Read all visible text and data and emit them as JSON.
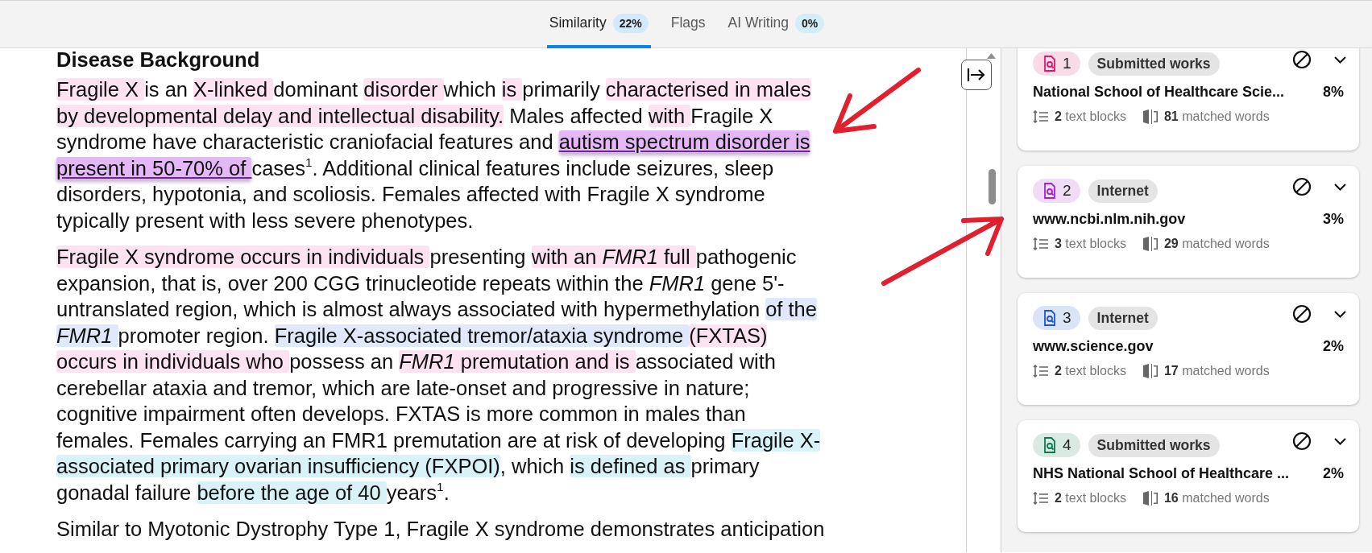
{
  "tabs": [
    {
      "label": "Similarity",
      "badge": "22%",
      "selected": true,
      "color": "#d4e9fb"
    },
    {
      "label": "Flags",
      "selected": false
    },
    {
      "label": "AI Writing",
      "badge": "0%",
      "selected": false,
      "color": "#d3eef8"
    }
  ],
  "document": {
    "heading": "Disease Background",
    "paragraphs": [
      {
        "lines": [
          {
            "segments": [
              {
                "text": "Fragile X ",
                "color": "#fde3f1",
                "active": false
              },
              {
                "text": "is an "
              },
              {
                "text": "X-linked ",
                "color": "#fde3f1",
                "active": false
              },
              {
                "text": "dominant "
              },
              {
                "text": "disorder ",
                "color": "#fde3f1",
                "active": false
              },
              {
                "text": "which "
              },
              {
                "text": "is ",
                "color": "#fde3f1",
                "active": false
              },
              {
                "text": "primarily "
              },
              {
                "text": "characterised in males",
                "color": "#fde3f1",
                "active": false
              }
            ]
          },
          {
            "segments": [
              {
                "text": "by developmental delay and intellectual disability.",
                "color": "#fde3f1",
                "active": false
              },
              {
                "text": " Males affected "
              },
              {
                "text": "with ",
                "color": "#fde3f1",
                "active": false
              },
              {
                "text": "Fragile X"
              }
            ]
          },
          {
            "segments": [
              {
                "text": "syndrome have characteristic craniofacial features and "
              },
              {
                "text": "autism spectrum disorder is ",
                "color": "#e4b8f6",
                "active": true
              }
            ]
          },
          {
            "segments": [
              {
                "text": "present in 50-70% of ",
                "color": "#e4b8f6",
                "active": true
              },
              {
                "text": "cases$^{1}$. Additional clinical features include seizures, sleep"
              }
            ]
          },
          {
            "segments": [
              {
                "text": "disorders, hypotonia, and scoliosis. Females affected with Fragile X syndrome"
              }
            ]
          },
          {
            "segments": [
              {
                "text": "typically present with less severe phenotypes."
              }
            ]
          }
        ]
      },
      {
        "lines": [
          {
            "segments": [
              {
                "text": "Fragile X syndrome occurs in individuals ",
                "color": "#fde3f1",
                "active": false
              },
              {
                "text": "presenting "
              },
              {
                "text": "with an *FMR1* full ",
                "color": "#fde3f1",
                "active": false
              },
              {
                "text": "pathogenic"
              }
            ]
          },
          {
            "segments": [
              {
                "text": "expansion, that is, over 200 CGG trinucleotide repeats within the *FMR1* gene 5'-"
              }
            ]
          },
          {
            "segments": [
              {
                "text": "untranslated region, which is almost always associated with hypermethylation "
              },
              {
                "text": "of the",
                "color": "#dfe9fb",
                "active": false
              }
            ]
          },
          {
            "segments": [
              {
                "text": "*FMR1* ",
                "color": "#dfe9fb",
                "active": false
              },
              {
                "text": "promoter region. "
              },
              {
                "text": "Fragile X-associated tremor/ataxia syndrome ",
                "color": "#dfe9fb",
                "active": false
              },
              {
                "text": "(FXTAS)",
                "color": "#fde3f1",
                "active": false
              }
            ]
          },
          {
            "segments": [
              {
                "text": "occurs in individuals who ",
                "color": "#fde3f1",
                "active": false
              },
              {
                "text": "possess an "
              },
              {
                "text": "*FMR1* premutation and is ",
                "color": "#fde3f1",
                "active": false
              },
              {
                "text": "associated with"
              }
            ]
          },
          {
            "segments": [
              {
                "text": "cerebellar ataxia and tremor, which are late-onset and progressive in nature;"
              }
            ]
          },
          {
            "segments": [
              {
                "text": "cognitive impairment often develops. FXTAS is more common in males than"
              }
            ]
          },
          {
            "segments": [
              {
                "text": "females. Females carrying an FMR1 premutation are at risk of developing "
              },
              {
                "text": "Fragile X-",
                "color": "#d8f2f8",
                "active": false
              }
            ]
          },
          {
            "segments": [
              {
                "text": "associated primary ovarian insufficiency (FXPOI)",
                "color": "#d8f2f8",
                "active": false
              },
              {
                "text": ", which "
              },
              {
                "text": "is defined as ",
                "color": "#d8f2f8",
                "active": false
              },
              {
                "text": "primary"
              }
            ]
          },
          {
            "segments": [
              {
                "text": "gonadal failure "
              },
              {
                "text": "before the age of 40 ",
                "color": "#d8f2f8",
                "active": false
              },
              {
                "text": "years$^{1}$."
              }
            ]
          }
        ]
      },
      {
        "lines": [
          {
            "segments": [
              {
                "text": "Similar to Myotonic Dystrophy Type 1, Fragile X syndrome demonstrates anticipation"
              }
            ]
          }
        ]
      }
    ]
  },
  "sources": [
    {
      "number": "1",
      "type": "Submitted works",
      "title": "National School of Healthcare Scie...",
      "percent": "8%",
      "blocks_count": "2",
      "blocks_label": "text blocks",
      "words_count": "81",
      "words_label": "matched words",
      "color": "#d81b72"
    },
    {
      "number": "2",
      "type": "Internet",
      "title": "www.ncbi.nlm.nih.gov",
      "percent": "3%",
      "blocks_count": "3",
      "blocks_label": "text blocks",
      "words_count": "29",
      "words_label": "matched words",
      "color": "#a723cc"
    },
    {
      "number": "3",
      "type": "Internet",
      "title": "www.science.gov",
      "percent": "2%",
      "blocks_count": "2",
      "blocks_label": "text blocks",
      "words_count": "17",
      "words_label": "matched words",
      "color": "#1f55c8"
    },
    {
      "number": "4",
      "type": "Submitted works",
      "title": "NHS National School of Healthcare ...",
      "percent": "2%",
      "blocks_count": "2",
      "blocks_label": "text blocks",
      "words_count": "16",
      "words_label": "matched words",
      "color": "#0b7a4c"
    }
  ]
}
